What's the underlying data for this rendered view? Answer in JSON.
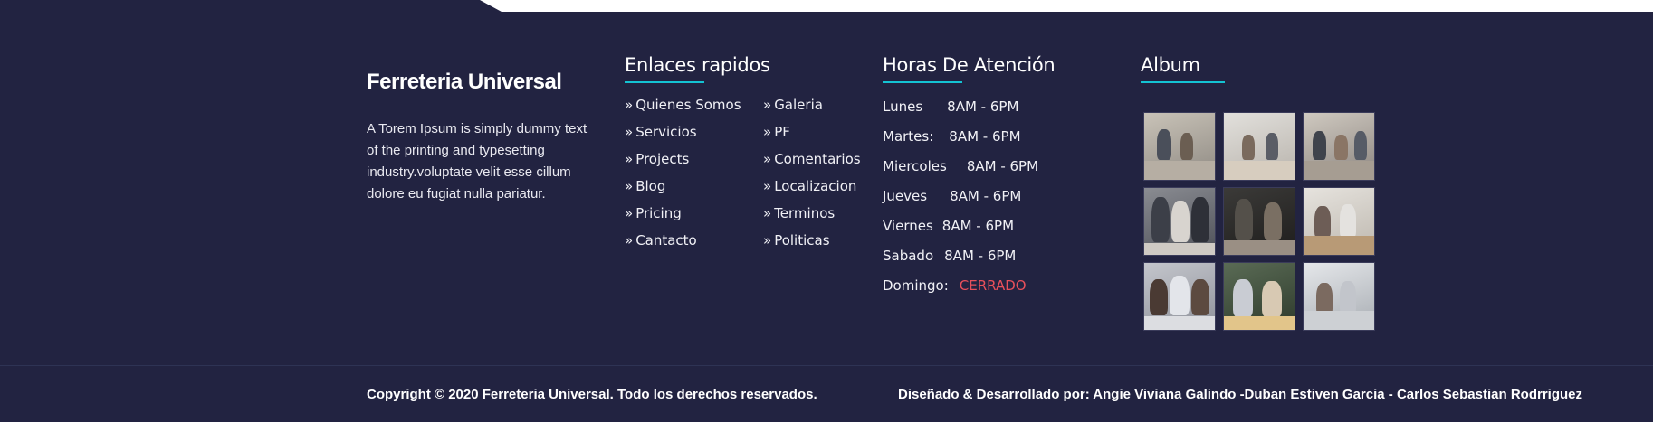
{
  "brand": {
    "title": "Ferreteria Universal",
    "description": "A Torem Ipsum is simply dummy text of the printing and typesetting industry.voluptate velit esse cillum dolore eu fugiat nulla pariatur."
  },
  "quick_links": {
    "heading": "Enlaces rapidos",
    "arrow": "»",
    "items": [
      "Quienes Somos",
      "Galeria",
      "Servicios",
      "PF",
      "Projects",
      "Comentarios",
      "Blog",
      "Localizacion",
      "Pricing",
      "Terminos",
      "Cantacto",
      "Politicas"
    ]
  },
  "hours": {
    "heading": "Horas De Atención",
    "rows": [
      {
        "day": "Lunes",
        "time": "8AM - 6PM"
      },
      {
        "day": "Martes:",
        "time": "8AM - 6PM"
      },
      {
        "day": "Miercoles",
        "time": "8AM - 6PM"
      },
      {
        "day": "Jueves",
        "time": "8AM - 6PM"
      },
      {
        "day": "Viernes",
        "time": "8AM - 6PM"
      },
      {
        "day": "Sabado",
        "time": "8AM - 6PM"
      },
      {
        "day": "Domingo:",
        "time": "CERRADO"
      }
    ],
    "closed_color": "#e8505b"
  },
  "album": {
    "heading": "Album",
    "photos": [
      "office-meeting-photo",
      "office-meeting-photo",
      "office-meeting-photo",
      "team-discussion-photo",
      "team-discussion-photo",
      "team-discussion-photo",
      "team-laptop-photo",
      "team-laptop-photo",
      "team-laptop-photo"
    ]
  },
  "footer": {
    "copyright": "Copyright © 2020 Ferreteria Universal. Todo los derechos reservados.",
    "credits": "Diseñado & Desarrollado por: Angie Viviana Galindo -Duban Estiven Garcia - Carlos Sebastian Rodrriguez"
  },
  "colors": {
    "background": "#222341",
    "accent": "#14c3d3"
  }
}
